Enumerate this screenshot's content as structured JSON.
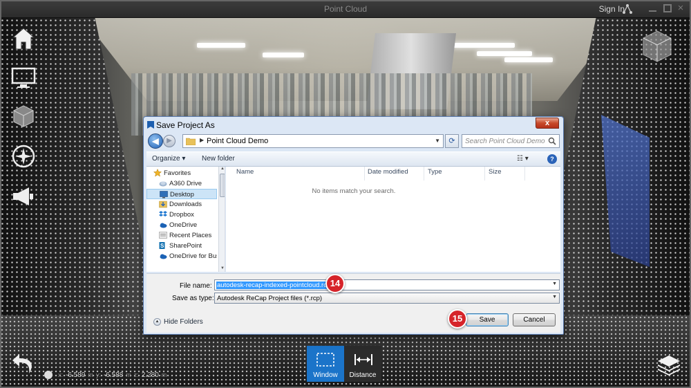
{
  "app": {
    "title": "Point Cloud",
    "sign_in": "Sign In"
  },
  "icons": {
    "home": "home-icon",
    "monitor": "monitor-icon",
    "cube": "cube-icon",
    "compass": "compass-icon",
    "megaphone": "megaphone-icon",
    "viewcube": "viewcube-icon",
    "undo": "undo-icon",
    "layers": "layers-icon",
    "share": "share-icon"
  },
  "coords": {
    "x_label": "x:",
    "x": "-6.589",
    "x_unit": "m",
    "y_label": "y:",
    "y": "-6.588",
    "y_unit": "m",
    "z_label": "z:",
    "z": "2.280",
    "z_unit": "m"
  },
  "measure_tools": {
    "window_label": "Window",
    "distance_label": "Distance",
    "window_color": "#1b74c9"
  },
  "dialog": {
    "title": "Save Project As",
    "close_glyph": "x",
    "address": "Point Cloud Demo",
    "search_placeholder": "Search Point Cloud Demo",
    "organize": "Organize ▾",
    "new_folder": "New folder",
    "help_glyph": "?",
    "nav_items": [
      {
        "label": "Favorites",
        "icon": "star-icon"
      },
      {
        "label": "A360 Drive",
        "icon": "cloud-drive-icon"
      },
      {
        "label": "Desktop",
        "icon": "desktop-icon",
        "selected": true
      },
      {
        "label": "Downloads",
        "icon": "downloads-folder-icon"
      },
      {
        "label": "Dropbox",
        "icon": "dropbox-icon"
      },
      {
        "label": "OneDrive",
        "icon": "onedrive-icon"
      },
      {
        "label": "Recent Places",
        "icon": "recent-places-icon"
      },
      {
        "label": "SharePoint",
        "icon": "sharepoint-icon"
      },
      {
        "label": "OneDrive for Bus",
        "icon": "onedrive-business-icon"
      }
    ],
    "columns": [
      "Name",
      "Date modified",
      "Type",
      "Size"
    ],
    "empty_message": "No items match your search.",
    "file_name_label": "File name:",
    "file_name_value": "autodesk-recap-indexed-pointcloud.rcp",
    "save_type_label": "Save as type:",
    "save_type_value": "Autodesk ReCap Project files (*.rcp)",
    "hide_folders": "Hide Folders",
    "save": "Save",
    "cancel": "Cancel"
  },
  "badges": {
    "step_14": "14",
    "step_15": "15",
    "color": "#d6242a"
  }
}
